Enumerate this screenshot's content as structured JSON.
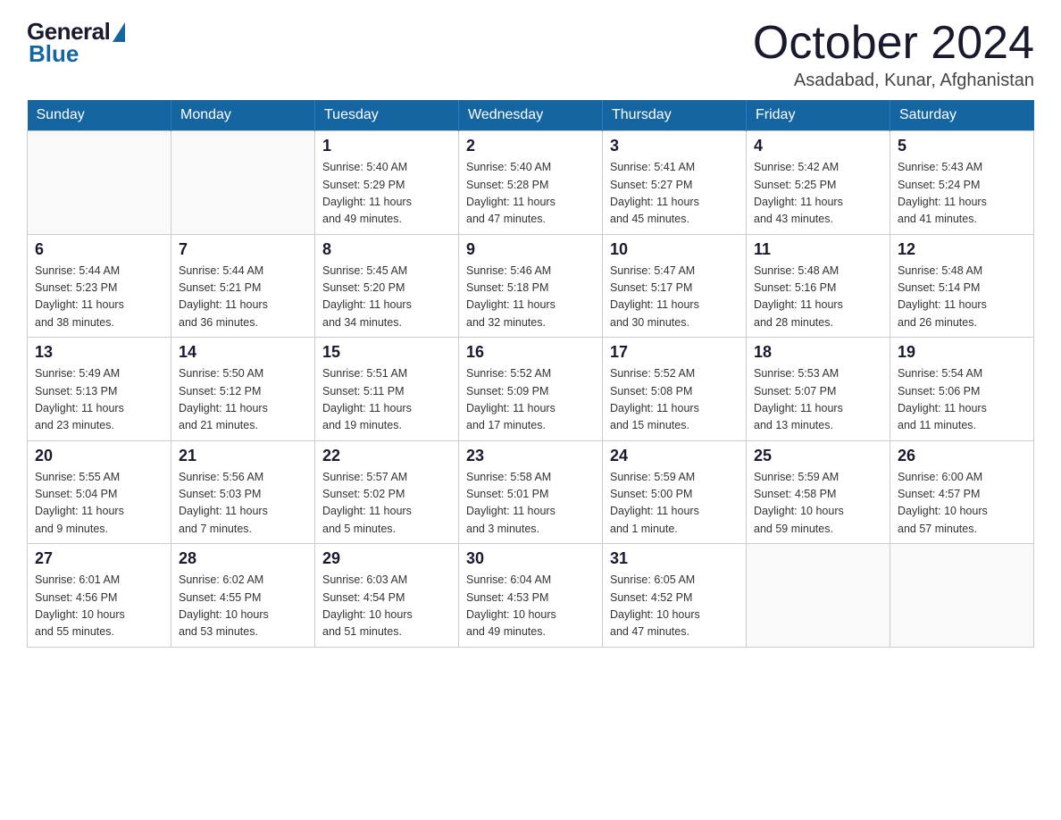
{
  "logo": {
    "general": "General",
    "blue": "Blue"
  },
  "title": "October 2024",
  "location": "Asadabad, Kunar, Afghanistan",
  "days_of_week": [
    "Sunday",
    "Monday",
    "Tuesday",
    "Wednesday",
    "Thursday",
    "Friday",
    "Saturday"
  ],
  "weeks": [
    [
      {
        "day": "",
        "info": ""
      },
      {
        "day": "",
        "info": ""
      },
      {
        "day": "1",
        "info": "Sunrise: 5:40 AM\nSunset: 5:29 PM\nDaylight: 11 hours\nand 49 minutes."
      },
      {
        "day": "2",
        "info": "Sunrise: 5:40 AM\nSunset: 5:28 PM\nDaylight: 11 hours\nand 47 minutes."
      },
      {
        "day": "3",
        "info": "Sunrise: 5:41 AM\nSunset: 5:27 PM\nDaylight: 11 hours\nand 45 minutes."
      },
      {
        "day": "4",
        "info": "Sunrise: 5:42 AM\nSunset: 5:25 PM\nDaylight: 11 hours\nand 43 minutes."
      },
      {
        "day": "5",
        "info": "Sunrise: 5:43 AM\nSunset: 5:24 PM\nDaylight: 11 hours\nand 41 minutes."
      }
    ],
    [
      {
        "day": "6",
        "info": "Sunrise: 5:44 AM\nSunset: 5:23 PM\nDaylight: 11 hours\nand 38 minutes."
      },
      {
        "day": "7",
        "info": "Sunrise: 5:44 AM\nSunset: 5:21 PM\nDaylight: 11 hours\nand 36 minutes."
      },
      {
        "day": "8",
        "info": "Sunrise: 5:45 AM\nSunset: 5:20 PM\nDaylight: 11 hours\nand 34 minutes."
      },
      {
        "day": "9",
        "info": "Sunrise: 5:46 AM\nSunset: 5:18 PM\nDaylight: 11 hours\nand 32 minutes."
      },
      {
        "day": "10",
        "info": "Sunrise: 5:47 AM\nSunset: 5:17 PM\nDaylight: 11 hours\nand 30 minutes."
      },
      {
        "day": "11",
        "info": "Sunrise: 5:48 AM\nSunset: 5:16 PM\nDaylight: 11 hours\nand 28 minutes."
      },
      {
        "day": "12",
        "info": "Sunrise: 5:48 AM\nSunset: 5:14 PM\nDaylight: 11 hours\nand 26 minutes."
      }
    ],
    [
      {
        "day": "13",
        "info": "Sunrise: 5:49 AM\nSunset: 5:13 PM\nDaylight: 11 hours\nand 23 minutes."
      },
      {
        "day": "14",
        "info": "Sunrise: 5:50 AM\nSunset: 5:12 PM\nDaylight: 11 hours\nand 21 minutes."
      },
      {
        "day": "15",
        "info": "Sunrise: 5:51 AM\nSunset: 5:11 PM\nDaylight: 11 hours\nand 19 minutes."
      },
      {
        "day": "16",
        "info": "Sunrise: 5:52 AM\nSunset: 5:09 PM\nDaylight: 11 hours\nand 17 minutes."
      },
      {
        "day": "17",
        "info": "Sunrise: 5:52 AM\nSunset: 5:08 PM\nDaylight: 11 hours\nand 15 minutes."
      },
      {
        "day": "18",
        "info": "Sunrise: 5:53 AM\nSunset: 5:07 PM\nDaylight: 11 hours\nand 13 minutes."
      },
      {
        "day": "19",
        "info": "Sunrise: 5:54 AM\nSunset: 5:06 PM\nDaylight: 11 hours\nand 11 minutes."
      }
    ],
    [
      {
        "day": "20",
        "info": "Sunrise: 5:55 AM\nSunset: 5:04 PM\nDaylight: 11 hours\nand 9 minutes."
      },
      {
        "day": "21",
        "info": "Sunrise: 5:56 AM\nSunset: 5:03 PM\nDaylight: 11 hours\nand 7 minutes."
      },
      {
        "day": "22",
        "info": "Sunrise: 5:57 AM\nSunset: 5:02 PM\nDaylight: 11 hours\nand 5 minutes."
      },
      {
        "day": "23",
        "info": "Sunrise: 5:58 AM\nSunset: 5:01 PM\nDaylight: 11 hours\nand 3 minutes."
      },
      {
        "day": "24",
        "info": "Sunrise: 5:59 AM\nSunset: 5:00 PM\nDaylight: 11 hours\nand 1 minute."
      },
      {
        "day": "25",
        "info": "Sunrise: 5:59 AM\nSunset: 4:58 PM\nDaylight: 10 hours\nand 59 minutes."
      },
      {
        "day": "26",
        "info": "Sunrise: 6:00 AM\nSunset: 4:57 PM\nDaylight: 10 hours\nand 57 minutes."
      }
    ],
    [
      {
        "day": "27",
        "info": "Sunrise: 6:01 AM\nSunset: 4:56 PM\nDaylight: 10 hours\nand 55 minutes."
      },
      {
        "day": "28",
        "info": "Sunrise: 6:02 AM\nSunset: 4:55 PM\nDaylight: 10 hours\nand 53 minutes."
      },
      {
        "day": "29",
        "info": "Sunrise: 6:03 AM\nSunset: 4:54 PM\nDaylight: 10 hours\nand 51 minutes."
      },
      {
        "day": "30",
        "info": "Sunrise: 6:04 AM\nSunset: 4:53 PM\nDaylight: 10 hours\nand 49 minutes."
      },
      {
        "day": "31",
        "info": "Sunrise: 6:05 AM\nSunset: 4:52 PM\nDaylight: 10 hours\nand 47 minutes."
      },
      {
        "day": "",
        "info": ""
      },
      {
        "day": "",
        "info": ""
      }
    ]
  ]
}
